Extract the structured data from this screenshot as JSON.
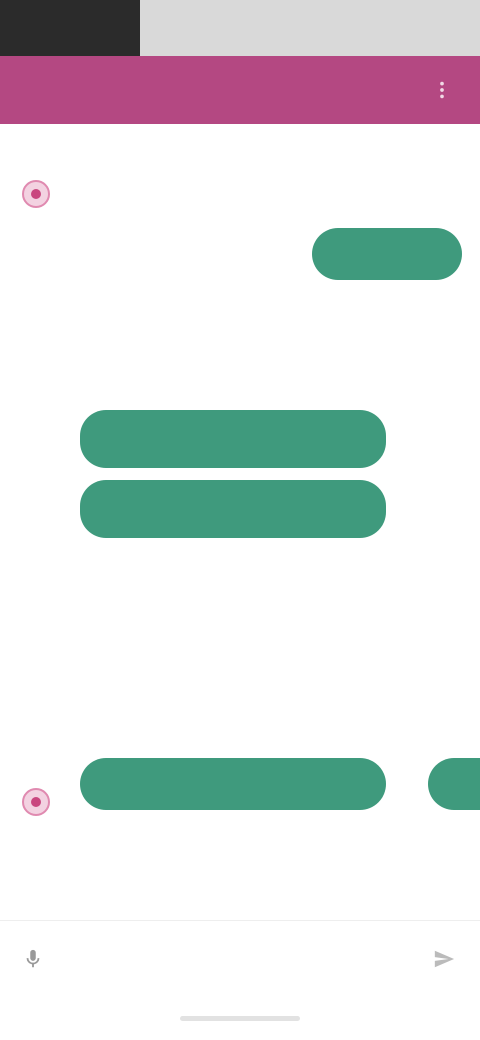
{
  "header": {
    "title": "",
    "menu_icon": "more-vert-icon",
    "color": "#b44882"
  },
  "messages": {
    "intro_text": "",
    "user_reply_label": "",
    "bot_prompt_text": "",
    "option_1_label": "",
    "option_2_label": "",
    "footnote_text": ""
  },
  "cards": [
    {
      "title": "",
      "description": "",
      "button_label": ""
    },
    {
      "title": "",
      "description": "",
      "button_label": ""
    }
  ],
  "composer": {
    "placeholder": "",
    "mic_icon": "mic-icon",
    "send_icon": "send-icon"
  },
  "colors": {
    "accent": "#3f9a7d",
    "brand": "#b44882"
  }
}
